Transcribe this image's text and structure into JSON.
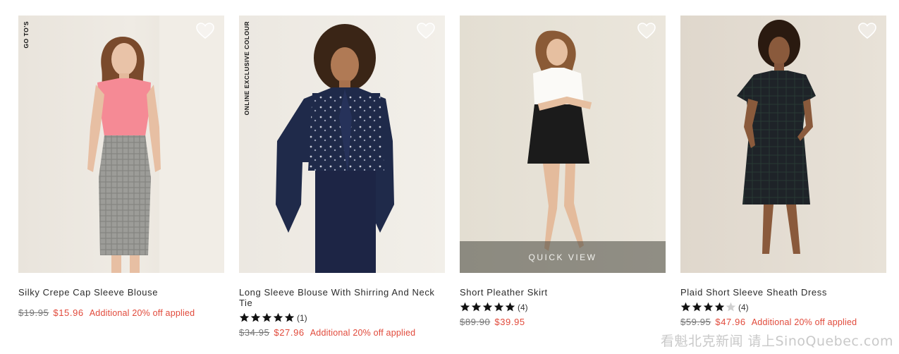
{
  "products": [
    {
      "badge": "GO TO'S",
      "name": "Silky Crepe Cap Sleeve Blouse",
      "rating": null,
      "review_count": "",
      "old_price": "$19.95",
      "sale_price": "$15.96",
      "promo": "Additional 20% off applied",
      "quick_view": ""
    },
    {
      "badge": "ONLINE EXCLUSIVE COLOUR",
      "name": "Long Sleeve Blouse With Shirring And Neck Tie",
      "rating": 5,
      "review_count": "(1)",
      "old_price": "$34.95",
      "sale_price": "$27.96",
      "promo": "Additional 20% off applied",
      "quick_view": ""
    },
    {
      "badge": "",
      "name": "Short Pleather Skirt",
      "rating": 5,
      "review_count": "(4)",
      "old_price": "$89.90",
      "sale_price": "$39.95",
      "promo": "",
      "quick_view": "QUICK VIEW"
    },
    {
      "badge": "",
      "name": "Plaid Short Sleeve Sheath Dress",
      "rating": 4,
      "review_count": "(4)",
      "old_price": "$59.95",
      "sale_price": "$47.96",
      "promo": "Additional 20% off applied",
      "quick_view": ""
    }
  ],
  "icons": {
    "wishlist": "heart-outline-icon",
    "star": "star-icon"
  },
  "colors": {
    "sale": "#e14a3b",
    "old_price": "#777777",
    "star_filled": "#111111",
    "star_empty": "#d0d0d0"
  },
  "watermark": "看魁北克新闻 请上SinoQuebec.com"
}
